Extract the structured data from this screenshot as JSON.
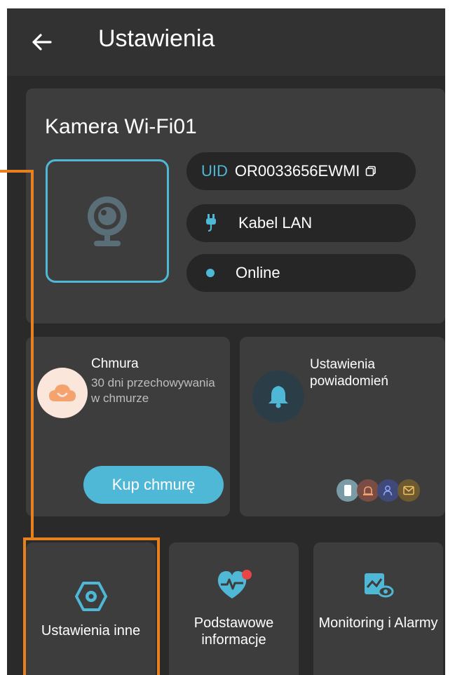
{
  "header": {
    "title": "Ustawienia",
    "back_icon": "arrow-left-icon"
  },
  "device": {
    "name": "Kamera Wi-Fi01",
    "uid_label": "UID",
    "uid_value": "OR0033656EWMI",
    "connection": "Kabel LAN",
    "status": "Online"
  },
  "cloud": {
    "title": "Chmura",
    "description": "30 dni przechowywania w chmurze",
    "button": "Kup chmurę"
  },
  "notifications": {
    "title": "Ustawienia powiadomień"
  },
  "tiles": [
    {
      "label": "Ustawienia inne"
    },
    {
      "label": "Podstawowe informacje"
    },
    {
      "label": "Monitoring i Alarmy"
    }
  ],
  "colors": {
    "accent": "#4fb8d6",
    "highlight": "#e8801e",
    "background": "#2a2a2a",
    "card": "#3d3d3d"
  }
}
